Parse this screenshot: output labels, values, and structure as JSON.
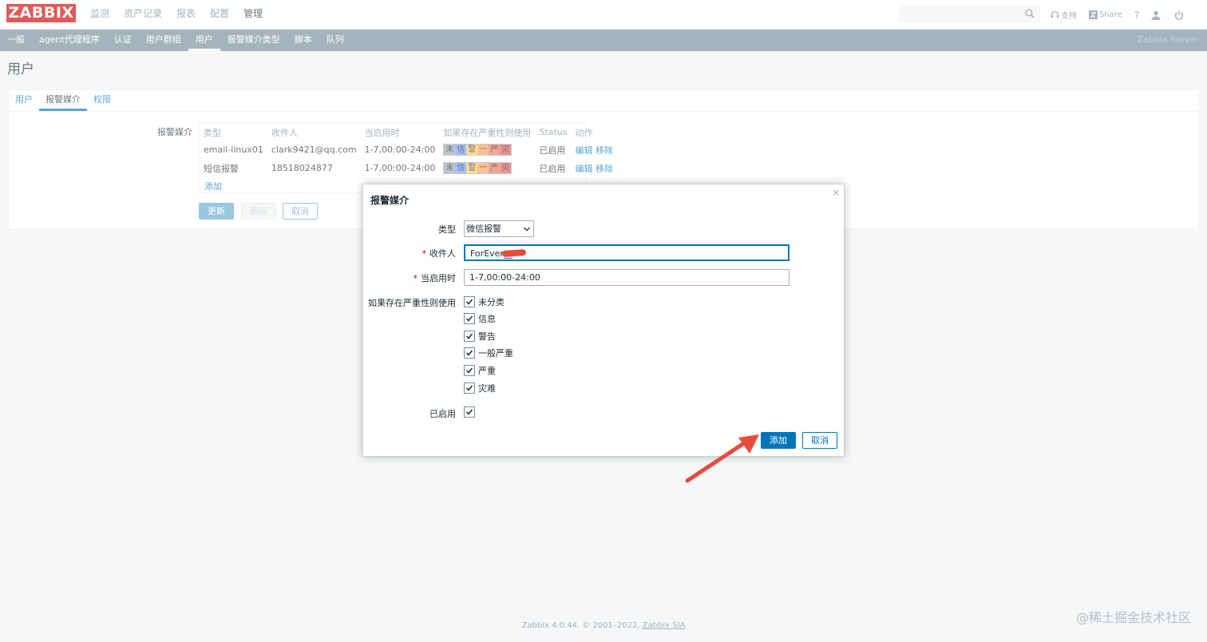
{
  "header": {
    "logo": "ZABBIX",
    "menu": [
      "监测",
      "资产记录",
      "报表",
      "配置",
      "管理"
    ],
    "active_menu": "管理",
    "support": "支持",
    "share": "Share",
    "help": "?"
  },
  "submenu": {
    "items": [
      "一般",
      "agent代理程序",
      "认证",
      "用户群组",
      "用户",
      "报警媒介类型",
      "脚本",
      "队列"
    ],
    "active": "用户",
    "server": "Zabbix Server"
  },
  "page_title": "用户",
  "tabs": [
    "用户",
    "报警媒介",
    "权限"
  ],
  "media": {
    "label": "报警媒介",
    "columns": [
      "类型",
      "收件人",
      "当启用时",
      "如果存在严重性则使用",
      "Status",
      "动作"
    ],
    "rows": [
      {
        "type": "email-linux01",
        "recipient": "clark9421@qq.com",
        "when": "1-7,00:00-24:00",
        "status": "已启用",
        "edit": "编辑",
        "remove": "移除"
      },
      {
        "type": "短信报警",
        "recipient": "18518024877",
        "when": "1-7,00:00-24:00",
        "status": "已启用",
        "edit": "编辑",
        "remove": "移除"
      }
    ],
    "severity_short": [
      "未",
      "信",
      "警",
      "一",
      "严",
      "灾"
    ],
    "severity_colors": [
      "#97aab3",
      "#7499ff",
      "#ffc859",
      "#ffa059",
      "#e97659",
      "#e45959"
    ],
    "add": "添加"
  },
  "buttons": {
    "update": "更新",
    "delete": "删除",
    "cancel": "取消"
  },
  "modal": {
    "title": "报警媒介",
    "close": "×",
    "type_label": "类型",
    "type_value": "微信报警",
    "recipient_label": "收件人",
    "recipient_value": "ForEver__",
    "when_label": "当启用时",
    "when_value": "1-7,00:00-24:00",
    "severity_label": "如果存在严重性则使用",
    "severities": [
      "未分类",
      "信息",
      "警告",
      "一般严重",
      "严重",
      "灾难"
    ],
    "enabled_label": "已启用",
    "add": "添加",
    "cancel": "取消"
  },
  "footer": {
    "text": "Zabbix 4.0.44. © 2001–2022, ",
    "link": "Zabbix SIA"
  },
  "watermark": "@稀土掘金技术社区"
}
